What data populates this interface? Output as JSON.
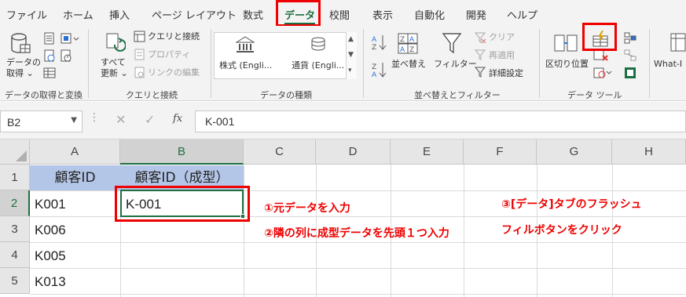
{
  "tabs": [
    "ファイル",
    "ホーム",
    "挿入",
    "ページ レイアウト",
    "数式",
    "データ",
    "校閲",
    "表示",
    "自動化",
    "開発",
    "ヘルプ"
  ],
  "active_tab": "データ",
  "ribbon": {
    "get_data": {
      "btn": "データの",
      "btn2": "取得 ⌄",
      "group": "データの取得と変換"
    },
    "queries": {
      "refresh1": "すべて",
      "refresh2": "更新 ⌄",
      "queries_conn": "クエリと接続",
      "properties": "プロパティ",
      "edit_links": "リンクの編集",
      "group": "クエリと接続"
    },
    "data_types": {
      "stocks": "株式 (Engli...",
      "currency": "通貨 (Engli...",
      "group": "データの種類"
    },
    "sort_filter": {
      "sort": "並べ替え",
      "filter": "フィルター",
      "clear": "クリア",
      "reapply": "再適用",
      "advanced": "詳細設定",
      "group": "並べ替えとフィルター"
    },
    "data_tools": {
      "text_to_columns": "区切り位置",
      "group": "データ ツール"
    },
    "whatif": "What-I"
  },
  "formula_bar": {
    "name_box": "B2",
    "fx": "fx",
    "value": "K-001"
  },
  "grid": {
    "columns": [
      "A",
      "B",
      "C",
      "D",
      "E",
      "F",
      "G",
      "H"
    ],
    "rows": [
      "1",
      "2",
      "3",
      "4",
      "5"
    ],
    "A": [
      "顧客ID",
      "K001",
      "K006",
      "K005",
      "K013"
    ],
    "B1": "顧客ID（成型）",
    "B2": "K-001"
  },
  "notes": {
    "n1": "①元データを入力",
    "n2": "②隣の列に成型データを先頭１つ入力",
    "n3": "③[データ]タブのフラッシュ",
    "n4": "フィルボタンをクリック"
  },
  "colors": {
    "accent": "#1d6f42",
    "highlight": "#e00000",
    "header_fill": "#b4c6e7"
  }
}
